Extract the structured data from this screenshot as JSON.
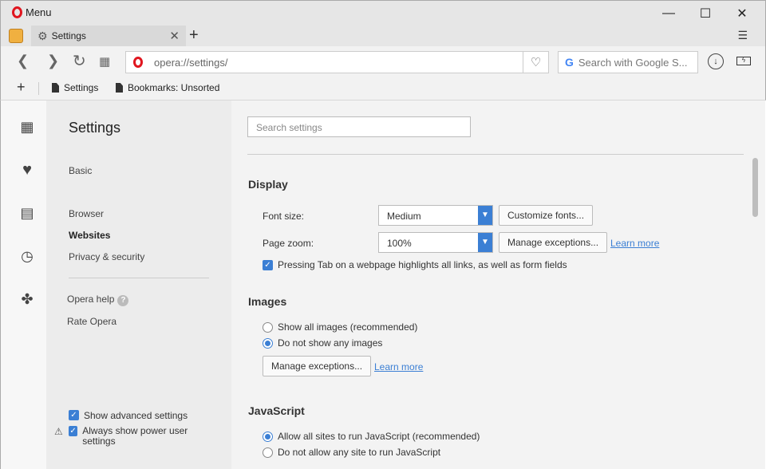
{
  "titlebar": {
    "menu_label": "Menu"
  },
  "tab": {
    "title": "Settings"
  },
  "address": {
    "url": "opera://settings/",
    "search_placeholder": "Search with Google S..."
  },
  "bookmarks": {
    "items": [
      "Settings",
      "Bookmarks: Unsorted"
    ]
  },
  "nav": {
    "title": "Settings",
    "basic": "Basic",
    "browser": "Browser",
    "websites": "Websites",
    "privacy": "Privacy & security",
    "help": "Opera help",
    "rate": "Rate Opera",
    "show_advanced": "Show advanced settings",
    "power_user": "Always show power user settings"
  },
  "content": {
    "search_placeholder": "Search settings",
    "display": {
      "title": "Display",
      "font_size_label": "Font size:",
      "font_size_value": "Medium",
      "customize_fonts": "Customize fonts...",
      "page_zoom_label": "Page zoom:",
      "page_zoom_value": "100%",
      "manage_exceptions": "Manage exceptions...",
      "learn_more": "Learn more",
      "tab_highlight": "Pressing Tab on a webpage highlights all links, as well as form fields"
    },
    "images": {
      "title": "Images",
      "show_all": "Show all images (recommended)",
      "show_none": "Do not show any images",
      "manage_exceptions": "Manage exceptions...",
      "learn_more": "Learn more"
    },
    "javascript": {
      "title": "JavaScript",
      "allow_all": "Allow all sites to run JavaScript (recommended)",
      "allow_none": "Do not allow any site to run JavaScript"
    }
  },
  "colors": {
    "accent": "#3b7fd4",
    "opera_red": "#e0161f"
  }
}
